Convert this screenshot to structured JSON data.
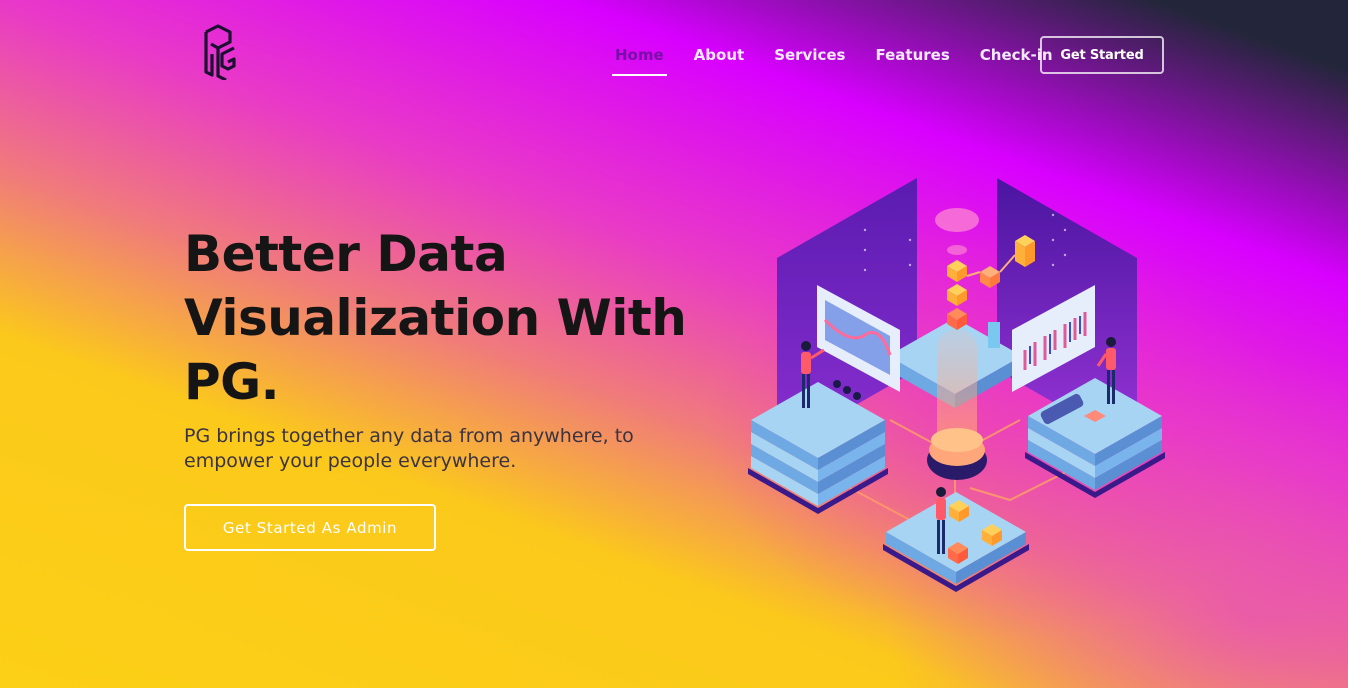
{
  "brand": {
    "logo_icon": "pg-monogram-logo-icon"
  },
  "nav": {
    "items": [
      {
        "label": "Home",
        "active": true
      },
      {
        "label": "About",
        "active": false
      },
      {
        "label": "Services",
        "active": false
      },
      {
        "label": "Features",
        "active": false
      },
      {
        "label": "Check-in",
        "active": false
      }
    ],
    "cta_label": "Get Started"
  },
  "hero": {
    "title_line1": "Better Data",
    "title_line2": "Visualization With",
    "title_line3": "PG.",
    "subtitle_line1": "PG brings together any data from anywhere, to",
    "subtitle_line2": "empower your people everywhere.",
    "button_label": "Get Started As Admin",
    "illustration_icon": "isometric-data-servers-illustration"
  },
  "colors": {
    "accent_dark": "#151515",
    "active_nav": "#7a0fa8",
    "gradient_top": "#d800ff",
    "gradient_bottom": "#fcd016",
    "corner_dark": "#23263a"
  }
}
